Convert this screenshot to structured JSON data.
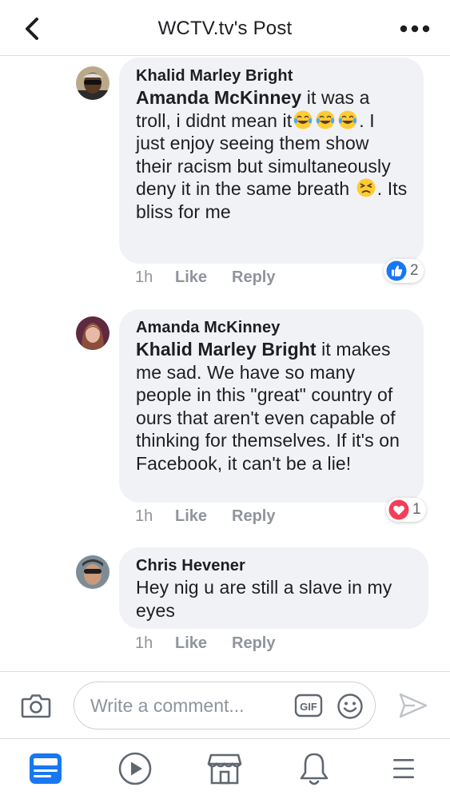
{
  "header": {
    "title": "WCTV.tv's Post",
    "back_icon": "chevron-left-icon",
    "more_icon": "more-horizontal-icon"
  },
  "comments": [
    {
      "author": "Khalid Marley Bright",
      "mention": "Amanda McKinney",
      "text_parts": [
        " it was a troll, i didnt mean it",
        ". I just enjoy seeing them show their racism but simultaneously deny it in the same breath ",
        ". Its bliss for me"
      ],
      "emojis": [
        "tears-of-joy-emoji",
        "persevering-face-emoji"
      ],
      "time": "1h",
      "like_label": "Like",
      "reply_label": "Reply",
      "reaction_icon": "like-reaction-icon",
      "reaction_count": "2"
    },
    {
      "author": "Amanda McKinney",
      "mention": "Khalid Marley Bright",
      "text": " it makes me sad. We have so many people in this \"great\" country of ours that aren't even capable of thinking for themselves. If it's on Facebook, it can't be a lie!",
      "time": "1h",
      "like_label": "Like",
      "reply_label": "Reply",
      "reaction_icon": "love-reaction-icon",
      "reaction_count": "1"
    },
    {
      "author": "Chris Hevener",
      "text": "Hey nig u are still a slave in my eyes",
      "time": "1h",
      "like_label": "Like",
      "reply_label": "Reply"
    }
  ],
  "composer": {
    "placeholder": "Write a comment...",
    "gif_label": "GIF"
  },
  "bottom_nav": [
    "news-feed-icon",
    "watch-icon",
    "marketplace-icon",
    "notifications-icon",
    "menu-icon"
  ],
  "colors": {
    "accent": "#1877f2",
    "love": "#f33e58",
    "bubble": "#f0f2f5",
    "muted_text": "#90949c"
  }
}
